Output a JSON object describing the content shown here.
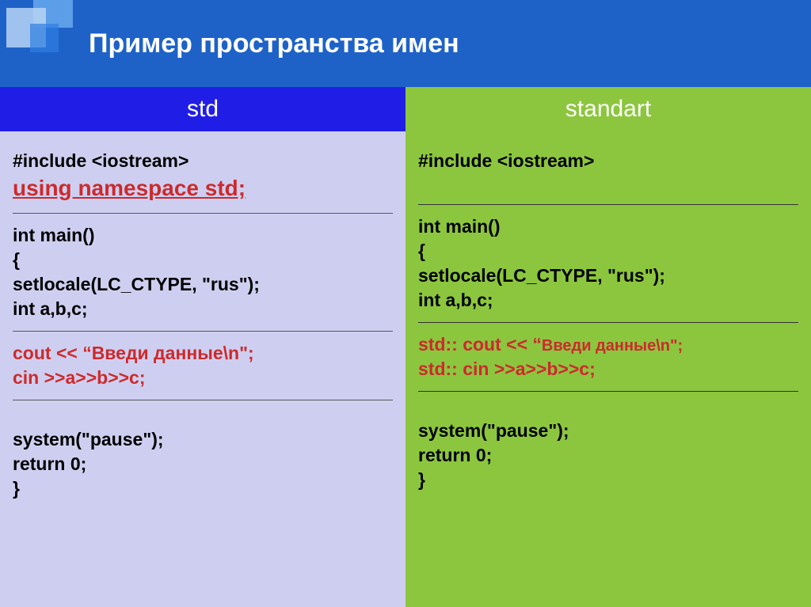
{
  "title": "Пример пространства имен",
  "columns": {
    "left": {
      "header": "std",
      "include": "#include <iostream>",
      "using": "using namespace std;",
      "main1": "int main()",
      "main2": "{",
      "main3": "setlocale(LC_CTYPE, \"rus\");",
      "main4": "int a,b,c;",
      "cout": "cout << “Введи данные\\n\";",
      "cin": "cin >>a>>b>>c;",
      "end1": "system(\"pause\");",
      "end2": "return 0;",
      "end3": "}"
    },
    "right": {
      "header": "standart",
      "include": "#include <iostream>",
      "main1": "int main()",
      "main2": "{",
      "main3": "setlocale(LC_CTYPE, \"rus\");",
      "main4": "int a,b,c;",
      "cout_prefix": "std:: cout << “",
      "cout_small": "Введи данные\\n\";",
      "cin_prefix": "std:: cin ",
      "cin_rest": ">>a>>b>>c;",
      "end1": "system(\"pause\");",
      "end2": "return 0;",
      "end3": "}"
    }
  }
}
